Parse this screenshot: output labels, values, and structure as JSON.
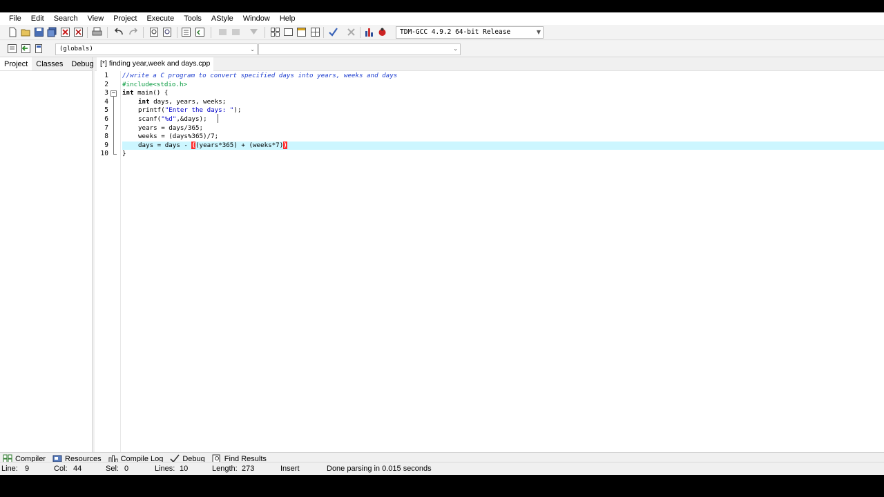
{
  "menu": [
    "File",
    "Edit",
    "Search",
    "View",
    "Project",
    "Execute",
    "Tools",
    "AStyle",
    "Window",
    "Help"
  ],
  "toolbar": {
    "compiler_value": "TDM-GCC 4.9.2 64-bit Release",
    "globals_value": "(globals)",
    "members_value": ""
  },
  "left_panel": {
    "tabs": [
      "Project",
      "Classes",
      "Debug"
    ]
  },
  "editor": {
    "tab_label": "[*] finding year,week and days.cpp",
    "line_numbers": [
      "1",
      "2",
      "3",
      "4",
      "5",
      "6",
      "7",
      "8",
      "9",
      "10"
    ],
    "lines": {
      "l1": "//write a C program to convert specified days into years, weeks and days",
      "l2": "#include<stdio.h>",
      "l3_kw": "int",
      "l3_rest": " main() {",
      "l4_kw": "int",
      "l4_rest": " days, years, weeks;",
      "l5_pre": "printf(",
      "l5_str": "\"Enter the days: \"",
      "l5_post": ");",
      "l6_pre": "scanf(",
      "l6_str": "\"%d\"",
      "l6_post": ",&days);",
      "l7": "years = days/365;",
      "l8": "weeks = (days%365)/7;",
      "l9_pre": "days = days - ",
      "l9_b1": "(",
      "l9_mid": "(years*365) + (weeks*7)",
      "l9_b2": ")",
      "l10": "}"
    }
  },
  "bottom_tabs": [
    "Compiler",
    "Resources",
    "Compile Log",
    "Debug",
    "Find Results"
  ],
  "status": {
    "line_label": "Line:",
    "line_value": "9",
    "col_label": "Col:",
    "col_value": "44",
    "sel_label": "Sel:",
    "sel_value": "0",
    "lines_label": "Lines:",
    "lines_value": "10",
    "length_label": "Length:",
    "length_value": "273",
    "mode": "Insert",
    "message": "Done parsing in 0.015 seconds"
  }
}
